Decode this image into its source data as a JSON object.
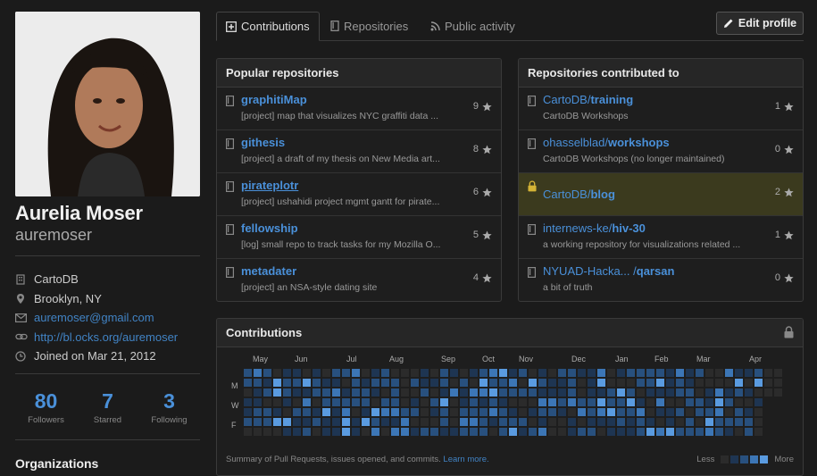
{
  "profile": {
    "fullname": "Aurelia Moser",
    "username": "auremoser",
    "organization": "CartoDB",
    "location": "Brooklyn, NY",
    "email": "auremoser@gmail.com",
    "url": "http://bl.ocks.org/auremoser",
    "joined": "Joined on Mar 21, 2012",
    "stats": [
      {
        "value": "80",
        "label": "Followers"
      },
      {
        "value": "7",
        "label": "Starred"
      },
      {
        "value": "3",
        "label": "Following"
      }
    ],
    "organizations_heading": "Organizations"
  },
  "tabs": [
    {
      "label": "Contributions",
      "icon": "contributions-icon",
      "selected": true
    },
    {
      "label": "Repositories",
      "icon": "repo-icon",
      "selected": false
    },
    {
      "label": "Public activity",
      "icon": "rss-icon",
      "selected": false
    }
  ],
  "edit_profile": "Edit profile",
  "popular": {
    "heading": "Popular repositories",
    "items": [
      {
        "name": "graphitiMap",
        "desc": "[project] map that visualizes NYC graffiti data ...",
        "stars": "9"
      },
      {
        "name": "githesis",
        "desc": "[project] a draft of my thesis on New Media art...",
        "stars": "8"
      },
      {
        "name": "pirateplotr",
        "desc": "[project] ushahidi project mgmt gantt for pirate...",
        "stars": "6"
      },
      {
        "name": "fellowship",
        "desc": "[log] small repo to track tasks for my Mozilla O...",
        "stars": "5"
      },
      {
        "name": "metadater",
        "desc": "[project] an NSA-style dating site",
        "stars": "4"
      }
    ]
  },
  "contributed": {
    "heading": "Repositories contributed to",
    "items": [
      {
        "owner": "CartoDB/",
        "name": "training",
        "desc": "CartoDB Workshops",
        "stars": "1",
        "private": false
      },
      {
        "owner": "ohasselblad/",
        "name": "workshops",
        "desc": "CartoDB Workshops (no longer maintained)",
        "stars": "0",
        "private": false
      },
      {
        "owner": "CartoDB/",
        "name": "blog",
        "desc": "",
        "stars": "2",
        "private": true
      },
      {
        "owner": "internews-ke/",
        "name": "hiv-30",
        "desc": "a working repository for visualizations related ...",
        "stars": "1",
        "private": false
      },
      {
        "owner": "NYUAD-Hacka... /",
        "name": "qarsan",
        "desc": "a bit of truth",
        "stars": "0",
        "private": false
      }
    ]
  },
  "contributions": {
    "heading": "Contributions",
    "months": [
      "May",
      "Jun",
      "Jul",
      "Aug",
      "Sep",
      "Oct",
      "Nov",
      "Dec",
      "Jan",
      "Feb",
      "Mar",
      "Apr"
    ],
    "days": [
      "M",
      "W",
      "F"
    ],
    "summary": "Summary of Pull Requests, issues opened, and commits.",
    "learn_more": "Learn more.",
    "legend_less": "Less",
    "legend_more": "More",
    "colors": [
      "#2b2b2b",
      "#1e3552",
      "#28507e",
      "#3c76b6",
      "#5a9be0"
    ]
  }
}
